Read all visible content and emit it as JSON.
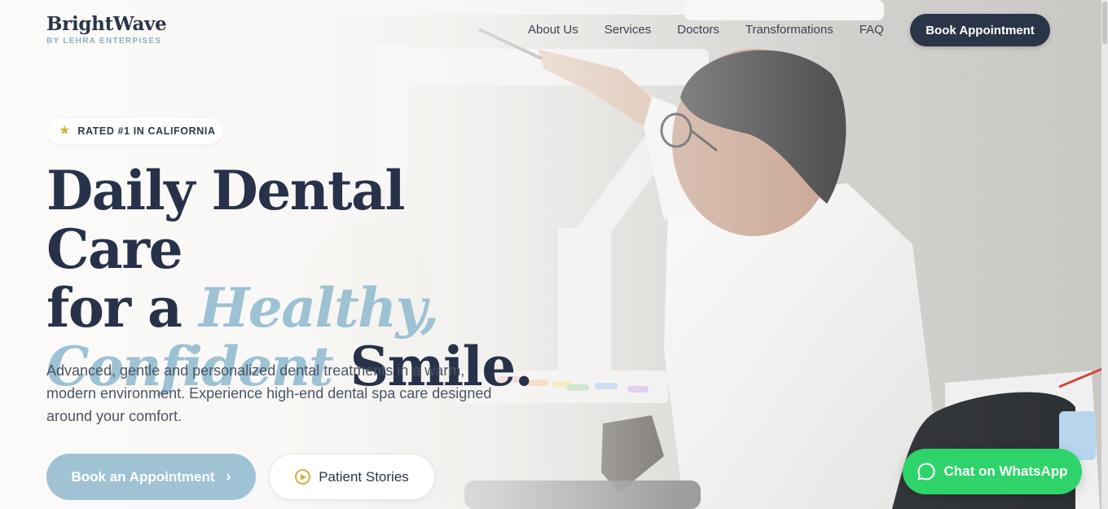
{
  "brand": {
    "name": "BrightWave",
    "tagline": "BY LEHRA ENTERPISES"
  },
  "nav": {
    "items": [
      {
        "label": "About Us"
      },
      {
        "label": "Services"
      },
      {
        "label": "Doctors"
      },
      {
        "label": "Transformations"
      },
      {
        "label": "FAQ"
      }
    ],
    "cta_label": "Book Appointment"
  },
  "hero": {
    "badge": {
      "icon": "star-icon",
      "text": "RATED #1 IN CALIFORNIA"
    },
    "headline": {
      "line1": "Daily Dental Care",
      "line2_start": "for a ",
      "line2_accent": "Healthy,",
      "line3_accent": "Confident",
      "line3_end": " Smile."
    },
    "description": "Advanced, gentle and personalized dental treatments in a warm, modern environment. Experience high-end dental spa care designed around your comfort.",
    "primary_button": {
      "label": "Book an Appointment",
      "icon": "chevron-right-icon"
    },
    "secondary_button": {
      "label": "Patient Stories",
      "icon": "play-circle-icon"
    }
  },
  "whatsapp": {
    "label": "Chat on WhatsApp",
    "icon": "chat-bubble-icon"
  },
  "colors": {
    "navy": "#2a3548",
    "accent_blue": "#9cc2d4",
    "gold": "#d2b13f",
    "whatsapp_green": "#2ed46a"
  }
}
